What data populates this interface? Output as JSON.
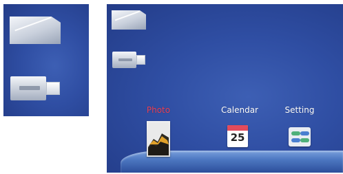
{
  "menu": {
    "items": [
      {
        "label": "Photo",
        "icon": "photo-icon",
        "selected": true
      },
      {
        "label": "Calendar",
        "icon": "calendar-icon",
        "selected": false,
        "day": "25"
      },
      {
        "label": "Setting",
        "icon": "settings-icon",
        "selected": false
      }
    ]
  },
  "storage": {
    "left_panel": [
      "sd-card-icon",
      "usb-drive-icon"
    ],
    "main_panel": [
      "sd-card-icon",
      "usb-drive-icon"
    ]
  },
  "colors": {
    "background": "#2f4ea3",
    "selected_label": "#e8425a",
    "label": "#ffffff",
    "dock": "#4d78c2"
  }
}
